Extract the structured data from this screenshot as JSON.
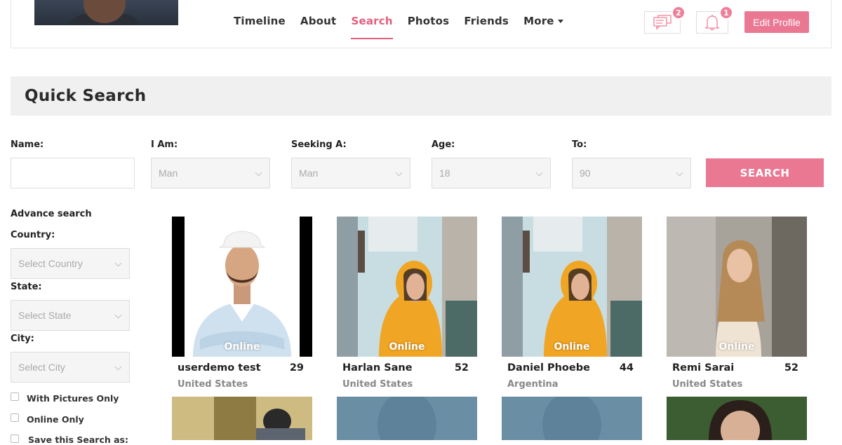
{
  "nav": {
    "items": [
      {
        "label": "Timeline",
        "active": false
      },
      {
        "label": "About",
        "active": false
      },
      {
        "label": "Search",
        "active": true
      },
      {
        "label": "Photos",
        "active": false
      },
      {
        "label": "Friends",
        "active": false
      },
      {
        "label": "More",
        "active": false
      }
    ]
  },
  "header": {
    "messages_count": "2",
    "notifications_count": "1",
    "edit_profile_label": "Edit Profile"
  },
  "quick_search": {
    "title": "Quick Search",
    "name_label": "Name:",
    "name_value": "",
    "i_am_label": "I Am:",
    "i_am_value": "Man",
    "seeking_label": "Seeking A:",
    "seeking_value": "Man",
    "age_label": "Age:",
    "age_from": "18",
    "to_label": "To:",
    "age_to": "90",
    "search_label": "SEARCH"
  },
  "advance": {
    "title": "Advance search",
    "country_label": "Country:",
    "country_placeholder": "Select Country",
    "state_label": "State:",
    "state_placeholder": "Select State",
    "city_label": "City:",
    "city_placeholder": "Select City",
    "with_pictures_label": "With Pictures Only",
    "online_only_label": "Online Only",
    "save_search_label": "Save this Search as:"
  },
  "colors": {
    "accent": "#ea7893",
    "active_nav": "#e0607d"
  },
  "results": [
    {
      "name": "userdemo test",
      "age": "29",
      "country": "United States",
      "status": "Online"
    },
    {
      "name": "Harlan Sane",
      "age": "52",
      "country": "United States",
      "status": "Online"
    },
    {
      "name": "Daniel Phoebe",
      "age": "44",
      "country": "Argentina",
      "status": "Online"
    },
    {
      "name": "Remi Sarai",
      "age": "52",
      "country": "United States",
      "status": "Online"
    }
  ]
}
